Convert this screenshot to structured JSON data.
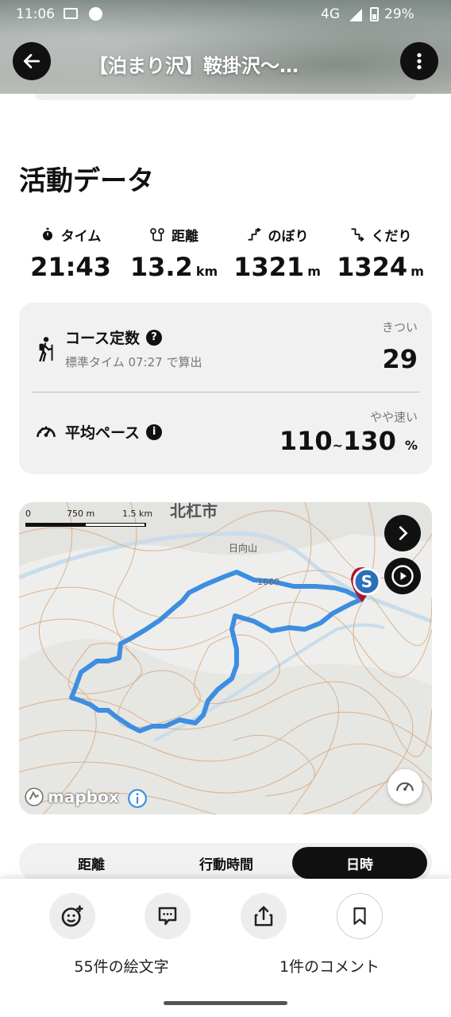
{
  "status_bar": {
    "time": "11:06",
    "network": "4G",
    "battery": "29%"
  },
  "header": {
    "title": "【泊まり沢】鞍掛沢〜…"
  },
  "activity": {
    "section_title": "活動データ",
    "stats": [
      {
        "label": "タイム",
        "icon": "stopwatch-icon",
        "value": "21:43",
        "unit": ""
      },
      {
        "label": "距離",
        "icon": "distance-icon",
        "value": "13.2",
        "unit": "km"
      },
      {
        "label": "のぼり",
        "icon": "ascent-icon",
        "value": "1321",
        "unit": "m"
      },
      {
        "label": "くだり",
        "icon": "descent-icon",
        "value": "1324",
        "unit": "m"
      }
    ],
    "course": {
      "title": "コース定数",
      "subtitle": "標準タイム 07:27 で算出",
      "tag": "きつい",
      "value": "29"
    },
    "pace": {
      "title": "平均ペース",
      "tag": "やや速い",
      "min": "110",
      "sep": "~",
      "max": "130",
      "unit": "%"
    }
  },
  "map": {
    "scale_labels": [
      "0",
      "750 m",
      "1.5 km"
    ],
    "place_city": "北杠市",
    "place_peak": "日向山",
    "elevation": "1660",
    "start_marker": "S",
    "attribution": "mapbox",
    "route_color": "#3d8ee0"
  },
  "segment": {
    "items": [
      "距離",
      "行動時間",
      "日時"
    ],
    "active": 2
  },
  "bottom": {
    "emoji_label": "55件の絵文字",
    "comment_label": "1件のコメント"
  }
}
